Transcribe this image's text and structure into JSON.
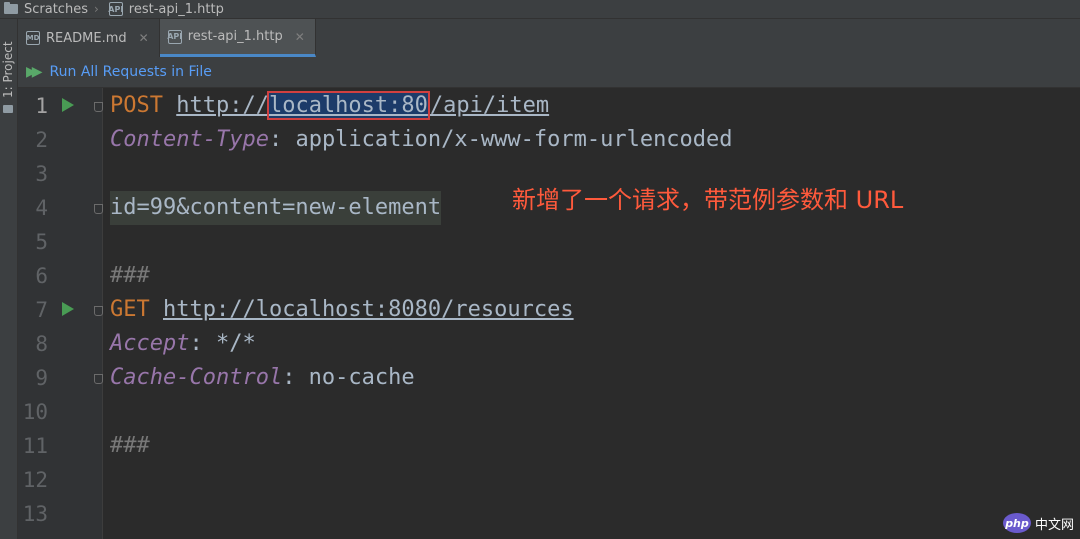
{
  "breadcrumb": {
    "root": "Scratches",
    "file": "rest-api_1.http"
  },
  "toolstrip": {
    "project_label": "1: Project"
  },
  "tabs": [
    {
      "label": "README.md",
      "icon": "markdown-file-icon"
    },
    {
      "label": "rest-api_1.http",
      "icon": "http-file-icon",
      "active": true
    }
  ],
  "runbar": {
    "label": "Run All Requests in File"
  },
  "editor": {
    "line_numbers": [
      "1",
      "2",
      "3",
      "4",
      "5",
      "6",
      "7",
      "8",
      "9",
      "10",
      "11",
      "12",
      "13"
    ],
    "l1": {
      "method": "POST",
      "url_pre": "http://",
      "url_sel": "localhost:80",
      "url_post": "/api/item"
    },
    "l2": {
      "header": "Content-Type",
      "colon": ":",
      "value": " application/x-www-form-urlencoded"
    },
    "l4": {
      "body": "id=99&content=new-element"
    },
    "l6": {
      "sep": "###"
    },
    "l7": {
      "method": "GET",
      "url": "http://localhost:8080/resources"
    },
    "l8": {
      "header": "Accept",
      "colon": ":",
      "value": " */*"
    },
    "l9": {
      "header": "Cache-Control",
      "colon": ":",
      "value": " no-cache"
    },
    "l11": {
      "sep": "###"
    }
  },
  "annotation": "新增了一个请求，带范例参数和 URL",
  "watermark": {
    "logo": "php",
    "text": "中文网"
  },
  "colors": {
    "keyword": "#cc7832",
    "header": "#9876aa",
    "annotation": "#ff5a3c",
    "run": "#499c54",
    "link": "#589df6"
  }
}
